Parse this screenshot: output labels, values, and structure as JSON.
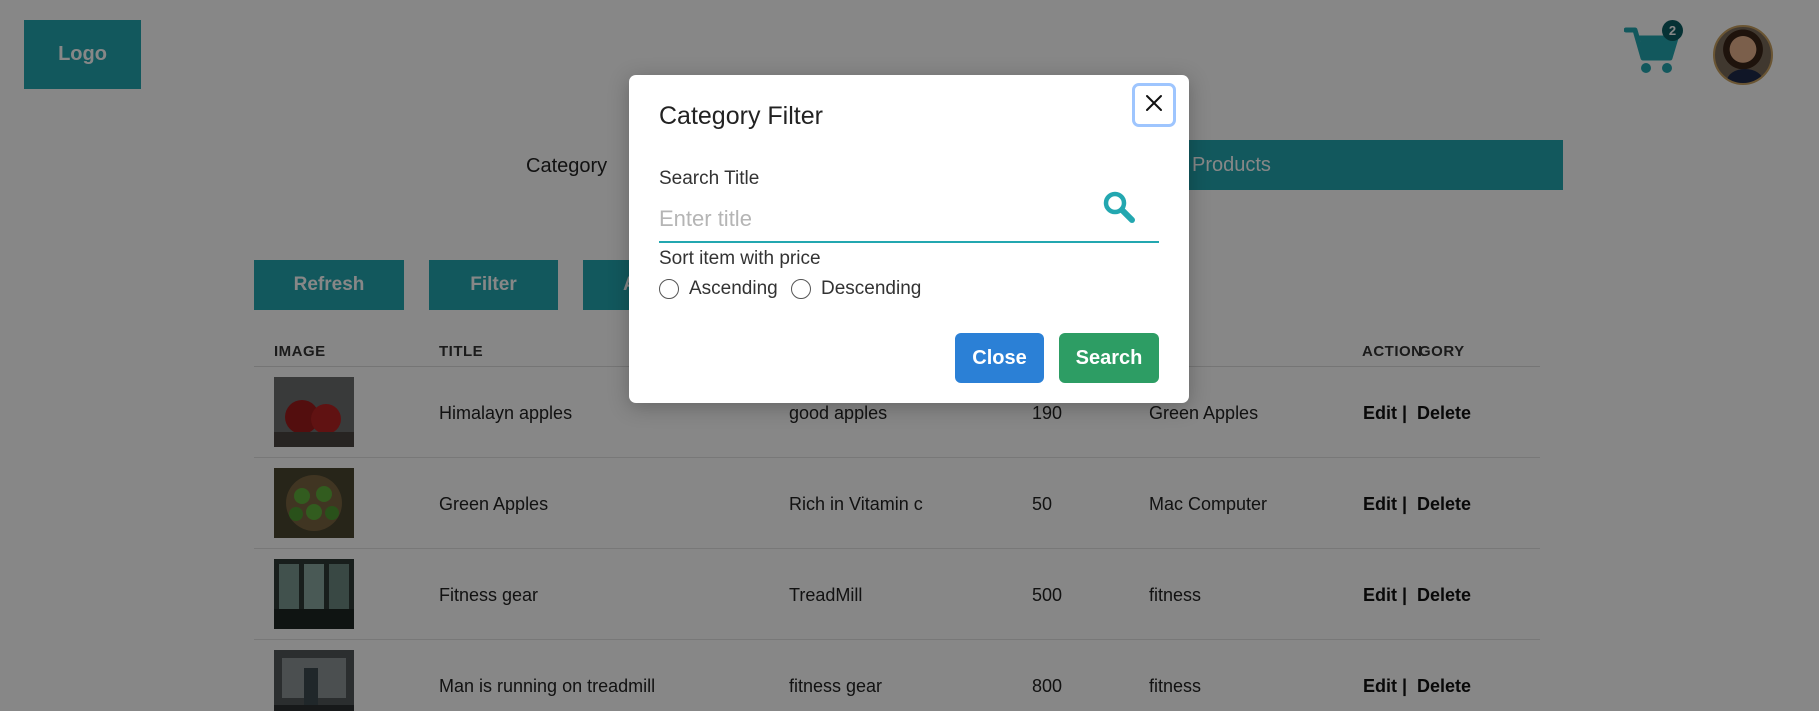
{
  "header": {
    "logo_text": "Logo",
    "cart_count": "2",
    "icons": {
      "cart": "shopping-cart-icon",
      "avatar": "user-avatar"
    }
  },
  "nav": {
    "category_label": "Category",
    "products_label": "Products"
  },
  "toolbar": {
    "refresh_label": "Refresh",
    "filter_label": "Filter",
    "add_label_partial": "A"
  },
  "table": {
    "headers": [
      "IMAGE",
      "TITLE",
      "",
      "",
      "GORY",
      "ACTION"
    ],
    "rows": [
      {
        "title": "Himalayn apples",
        "description": "good apples",
        "price": "190",
        "category": "Green Apples"
      },
      {
        "title": "Green Apples",
        "description": "Rich in Vitamin c",
        "price": "50",
        "category": "Mac Computer"
      },
      {
        "title": "Fitness gear",
        "description": "TreadMill",
        "price": "500",
        "category": "fitness"
      },
      {
        "title": "Man is running on treadmill",
        "description": "fitness gear",
        "price": "800",
        "category": "fitness"
      }
    ],
    "edit_label": "Edit |",
    "delete_label": "Delete"
  },
  "modal": {
    "title": "Category Filter",
    "search_label": "Search Title",
    "search_placeholder": "Enter title",
    "search_value": "",
    "sort_label": "Sort item with price",
    "ascending_label": "Ascending",
    "descending_label": "Descending",
    "close_label": "Close",
    "search_button_label": "Search"
  },
  "colors": {
    "accent": "#23a7b0",
    "close_button": "#2b80d6",
    "search_button": "#2d9d64",
    "badge": "#0a5d63"
  }
}
